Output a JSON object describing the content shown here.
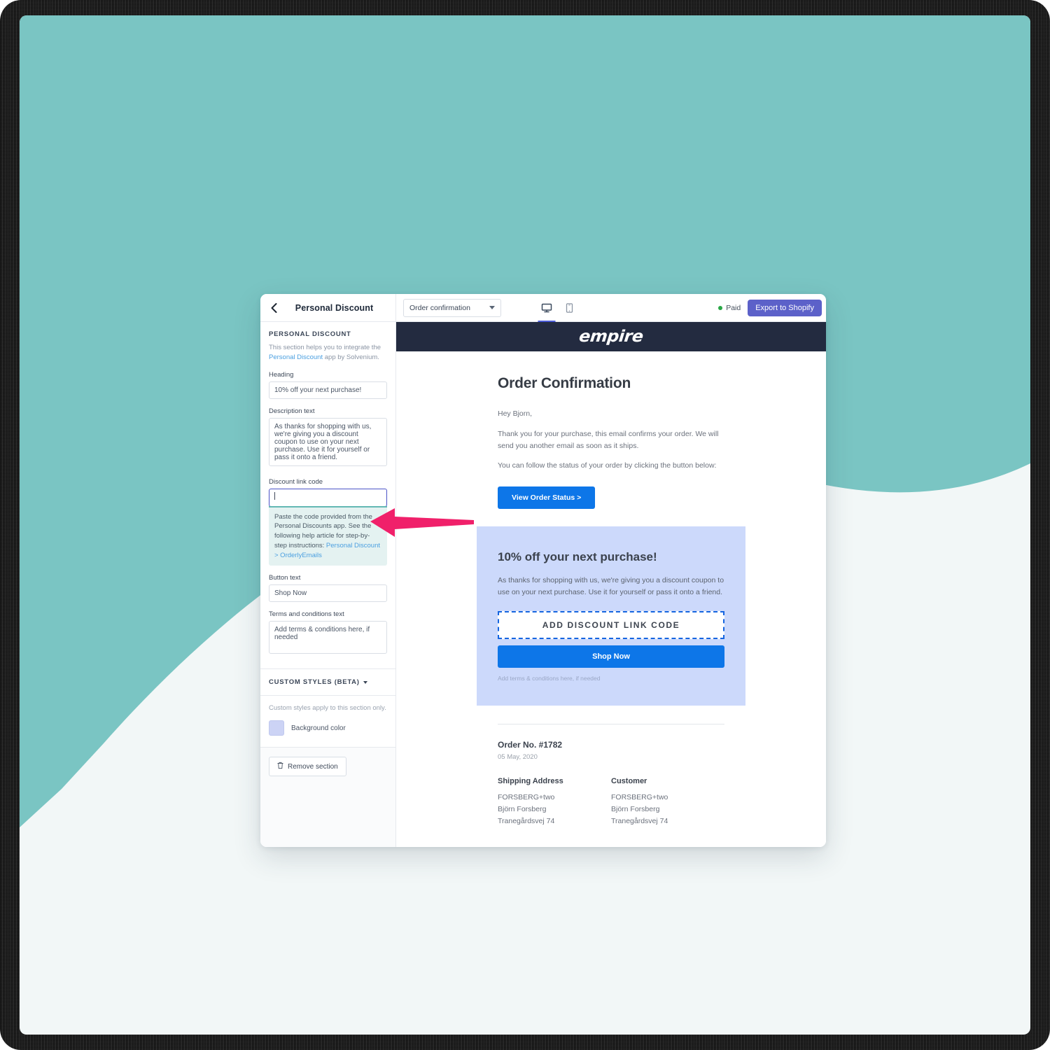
{
  "theme": {
    "background": "#f2f7f7",
    "teal": "#7ac5c3",
    "accent_purple": "#5c61c9",
    "accent_blue": "#0d76e8",
    "arrow_pink": "#f0206a",
    "email_header": "#232b40",
    "discount_block_bg": "#ccd9fb",
    "help_box_bg": "#e4f2f1",
    "help_box_border": "#63b8b4"
  },
  "topbar": {
    "back_icon": "chevron-left-icon",
    "title": "Personal Discount",
    "template_select": {
      "value": "Order confirmation",
      "caret_icon": "chevron-down-icon"
    },
    "devices": [
      {
        "name": "desktop-preview",
        "icon": "desktop-icon",
        "active": true
      },
      {
        "name": "mobile-preview",
        "icon": "mobile-icon",
        "active": false
      }
    ],
    "status": {
      "label": "Paid",
      "dot_color": "#29a745"
    },
    "export_button": "Export to Shopify"
  },
  "sidebar": {
    "section_title": "PERSONAL DISCOUNT",
    "section_desc_part1": "This section helps you to integrate the ",
    "section_desc_link": "Personal Discount",
    "section_desc_part2": " app by Solvenium.",
    "fields": {
      "heading_label": "Heading",
      "heading_value": "10% off your next purchase!",
      "description_label": "Description text",
      "description_value": "As thanks for shopping with us, we're giving you a discount coupon to use on your next purchase. Use it for yourself or pass it onto a friend.",
      "discount_code_label": "Discount link code",
      "discount_code_value": "",
      "discount_code_placeholder": "",
      "help_text_part1": "Paste the code provided from the Personal Discounts app. See the following help article for step-by-step instructions: ",
      "help_text_link": "Personal Discount > OrderlyEmails",
      "button_text_label": "Button text",
      "button_text_value": "Shop Now",
      "terms_label": "Terms and conditions text",
      "terms_value": "Add terms & conditions here, if needed"
    },
    "custom_styles": {
      "title": "CUSTOM STYLES (BETA)",
      "caret_icon": "chevron-down-icon",
      "note": "Custom styles apply to this section only.",
      "background_color_label": "Background color",
      "background_color_value": "#ccd3f5"
    },
    "remove_section": {
      "icon": "trash-icon",
      "label": "Remove section"
    }
  },
  "email": {
    "logo": "empire",
    "title": "Order Confirmation",
    "greeting": "Hey Bjorn,",
    "paragraph_1": "Thank you for your purchase, this email confirms your order. We will send you another email as soon as it ships.",
    "paragraph_2": "You can follow the status of your order by clicking the button below:",
    "view_order_button": "View Order Status >",
    "discount": {
      "heading": "10% off your next purchase!",
      "body": "As thanks for shopping with us, we're giving you a discount coupon to use on your next purchase. Use it for yourself or pass it onto a friend.",
      "add_code_button": "ADD DISCOUNT LINK CODE",
      "shop_now_button": "Shop Now",
      "terms": "Add terms & conditions here, if needed"
    },
    "order_no": "Order No. #1782",
    "order_date": "05 May, 2020",
    "shipping": {
      "title": "Shipping Address",
      "lines": [
        "FORSBERG+two",
        "Björn Forsberg",
        "Tranegårdsvej 74"
      ]
    },
    "customer": {
      "title": "Customer",
      "lines": [
        "FORSBERG+two",
        "Björn Forsberg",
        "Tranegårdsvej 74"
      ]
    }
  },
  "annotation": {
    "arrow": "left-pointing-arrow",
    "target": "discount-link-code-input"
  }
}
